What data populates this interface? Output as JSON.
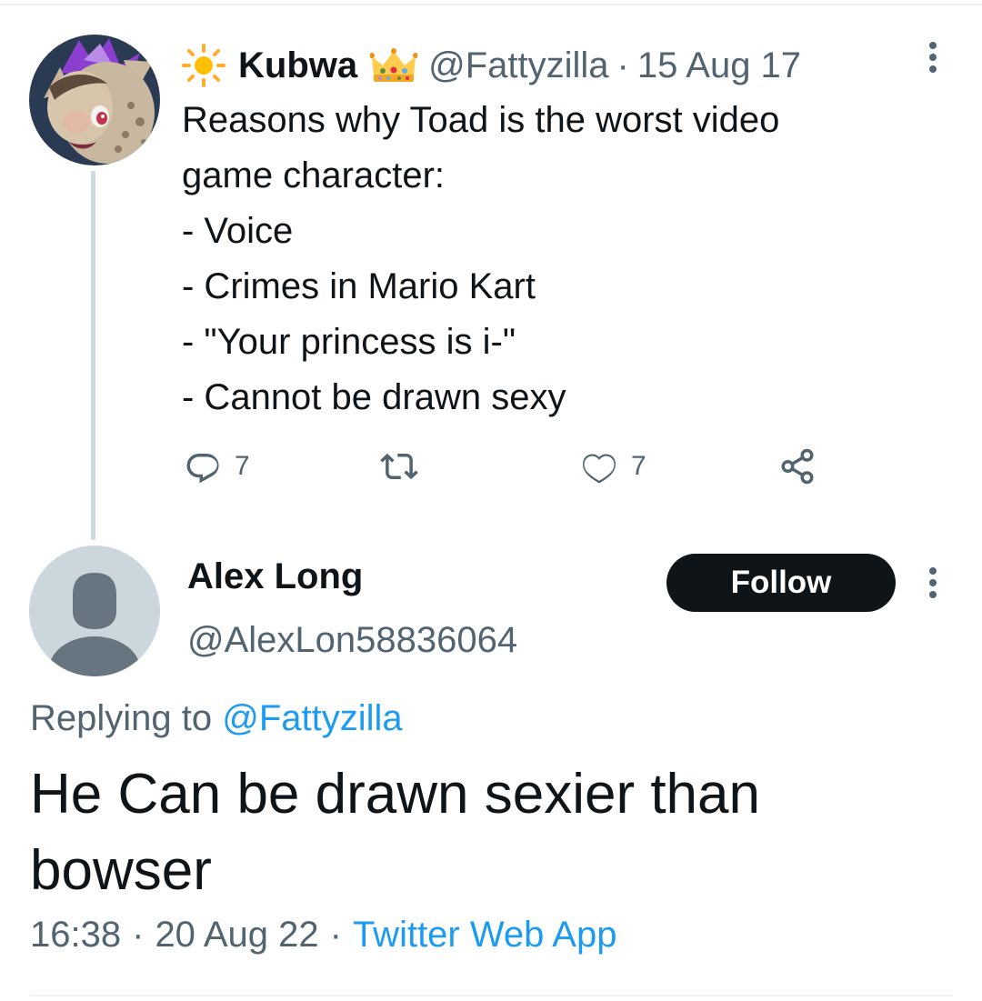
{
  "original_tweet": {
    "display_name": "Kubwa",
    "handle": "@Fattyzilla",
    "separator": "·",
    "date": "15 Aug 17",
    "name_icons": [
      "sun-emoji",
      "crown-emoji"
    ],
    "text_lines": [
      "Reasons why Toad is the worst video",
      "game character:",
      "- Voice",
      "- Crimes in Mario Kart",
      "- \"Your princess is i-\"",
      "- Cannot be drawn sexy"
    ],
    "reply_count": "7",
    "like_count": "7"
  },
  "reply_tweet": {
    "display_name": "Alex Long",
    "handle": "@AlexLon58836064",
    "follow_label": "Follow",
    "replying_prefix": "Replying to",
    "replying_to": "@Fattyzilla",
    "text": "He Can be drawn sexier than bowser",
    "time": "16:38",
    "separator": "·",
    "date": "20 Aug 22",
    "source": "Twitter Web App"
  },
  "colors": {
    "text_primary": "#0f1419",
    "text_secondary": "#536471",
    "link": "#1d9bf0",
    "thread_line": "#cfd9de",
    "follow_bg": "#0f1419"
  }
}
